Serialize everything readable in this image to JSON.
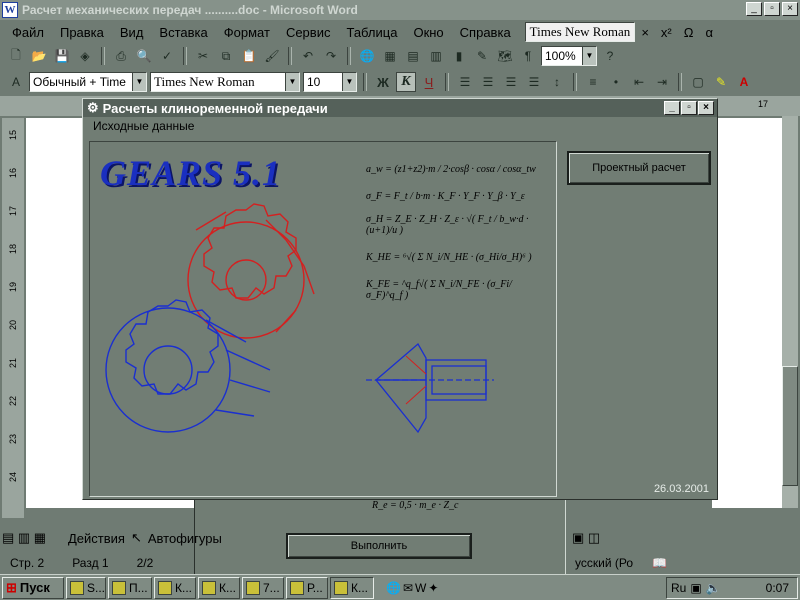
{
  "word_window": {
    "title": "Расчет механических передач ..........doc - Microsoft Word",
    "controls": [
      "minimize",
      "restore",
      "close"
    ]
  },
  "menu": {
    "items": [
      "Файл",
      "Правка",
      "Вид",
      "Вставка",
      "Формат",
      "Сервис",
      "Таблица",
      "Окно",
      "Справка"
    ],
    "font_box": "Times New Roman",
    "extras": [
      "×",
      "x²",
      "Ω",
      "α"
    ]
  },
  "toolbar_standard": {
    "zoom": "100%"
  },
  "toolbar_format": {
    "style": "Обычный + Time",
    "font": "Times New Roman",
    "size": "10",
    "bold_label": "Ж",
    "italic_label": "К",
    "underline_label": "Ч"
  },
  "ruler_vertical": [
    "15",
    "16",
    "17",
    "18",
    "19",
    "20",
    "21",
    "22",
    "23",
    "24"
  ],
  "ruler_h_label": "17",
  "dialog": {
    "title": "Расчеты клиноременной передачи",
    "menu_item": "Исходные данные",
    "logo": "GEARS 5.1",
    "project_button": "Проектный расчет",
    "date": "26.03.2001",
    "execute_button": "Выполнить",
    "formulas": [
      "a_w = (z1+z2)·m / 2·cosβ · cosα / cosα_tw",
      "σ_F = F_t / b·m · K_F · Y_F · Y_β · Y_ε",
      "σ_H = Z_E · Z_H · Z_ε · √( F_t / b_w·d · (u+1)/u )",
      "K_HE = ⁶√( Σ N_i/N_HE · (σ_Hi/σ_H)⁶ )",
      "K_FE = ^q_f√( Σ N_i/N_FE · (σ_Fi/σ_F)^q_f )",
      "R_e = 0,5 · m_e · Z_c"
    ]
  },
  "drawbar": {
    "actions": "Действия",
    "autoshapes": "Автофигуры"
  },
  "statusbar": {
    "page": "Стр. 2",
    "section": "Разд 1",
    "pages": "2/2",
    "language": "усский (Ро"
  },
  "taskbar": {
    "start": "Пуск",
    "buttons": [
      "S...",
      "П...",
      "К...",
      "К...",
      "7...",
      "Р...",
      "К..."
    ],
    "lang": "Ru",
    "clock": "0:07"
  }
}
